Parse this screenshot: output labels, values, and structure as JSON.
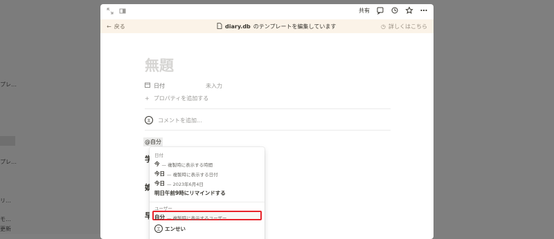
{
  "background": {
    "sidebar_fragments": [
      "プレ…",
      "プレ…",
      "リ…",
      "モ…",
      "更新"
    ]
  },
  "topbar": {
    "share_label": "共有"
  },
  "template_bar": {
    "back_label": "戻る",
    "db_name": "diary.db",
    "message": "のテンプレートを編集しています",
    "help_label": "詳しくはこちら"
  },
  "page": {
    "title_placeholder": "無題",
    "properties": [
      {
        "name": "日付",
        "value": "未入力",
        "icon": "calendar-icon"
      }
    ],
    "add_property_label": "プロパティを追加する",
    "comment_placeholder": "コメントを追加...",
    "mention_text": "@自分",
    "heading_fragments": [
      "学",
      "娯",
      "早"
    ]
  },
  "dropdown": {
    "date_section_label": "日付",
    "date_items": [
      {
        "main": "今",
        "sub": "— 複製時に表示する時間"
      },
      {
        "main": "今日",
        "sub": "— 複製時に表示する日付"
      },
      {
        "main": "今日",
        "sub": "— 2023年6月4日"
      },
      {
        "main": "明日午前9時にリマインドする",
        "sub": ""
      }
    ],
    "user_section_label": "ユーザー",
    "user_items": [
      {
        "main": "自分",
        "sub": "— 複製時に表示するユーザー",
        "highlighted": true
      },
      {
        "main": "エンせい",
        "sub": "",
        "avatar": "エ"
      }
    ]
  },
  "colors": {
    "highlight_border": "#e8232a",
    "template_bar_bg": "#fbf3e8",
    "overlay": "#7f7f7f"
  }
}
